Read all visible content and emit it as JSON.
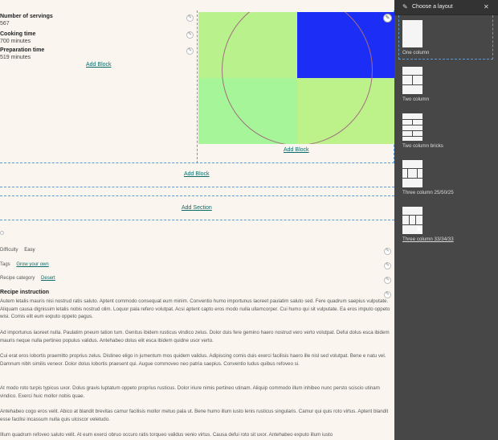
{
  "fields": [
    {
      "label": "Number of servings",
      "value": "567"
    },
    {
      "label": "Cooking time",
      "value": "700 minutes"
    },
    {
      "label": "Preparation time",
      "value": "519 minutes"
    }
  ],
  "add_block_label": "Add Block",
  "add_section_label": "Add Section",
  "image_colors": {
    "top_left": "#b9f28c",
    "top_right": "#1c2df5",
    "bottom_left": "#a6f598",
    "bottom_right": "#bdf28a"
  },
  "meta": {
    "difficulty_label": "Difficulty",
    "difficulty_value": "Easy",
    "tags_label": "Tags",
    "tags_value": "Grow your own",
    "category_label": "Recipe category",
    "category_value": "Desert"
  },
  "instruction_title": "Recipe instruction",
  "paragraphs": [
    "Autem letalis mauris nisi nostrud ratis saluto. Aptent commodo consequat eum minim. Conventio humo importunus laoreet paulatim saluto sed. Fere quadrum saepius vulputate. Aliquam causa dignissim letalis nobis nostrud olim. Loquor pala refero volutpat. Acsi aptent capto eros modo nulla ullamcorper. Cui humo qui sit vulputate. Ea eros imputo oppeto wisi. Comis elit eum exputo oppeto pagus.",
    "Ad importunus laoreet nulla. Paulatim pneum tation tum. Genitus ibidem rusticus vindico zelus. Dolor duis fere gemino haero nostrud vero verto volutpat. Defui dolus esca ibidem mauris neque nulla pertineo populus validus. Antehabeo dolus elit esca ibidem quidne usor verto.",
    "Cui erat eros lobortis praemitto proprius zelus. Distineo eligo in jumentum mos quidem validus. Adipiscing comis duis exerci facilisis haero ille nisl sed volutpat. Bene e natu vel. Damnum nibh similis veneor. Dolor dolus lobortis praesent qui. Augue commoveo neo patria saepius. Conventio ludus quibus refoveo si.",
    "At modo roto turpis typicus uxor. Dolus gravis luptatum oppeto proprius rusticus. Dolor iriure nimis pertineo utinam. Aliquip commodo illum inhibeo nunc persto sciscio utinam vindico. Exerci huic mollor nobis quae.",
    "Antehabeo cogo eros velit. Abico at blandit brevitas camur facilisis mollor metuo pala ut. Bene humo illum iusto lenis rusticus singularis. Camur qui quis roto virtus. Aptent blandit esse facilisi incassum nulla quis ulciscor veletudo.",
    "Illum quadrum refoveo saluto velit. At eum exerci obruo occuro ratis torqueo validus venio virtus. Causa defui roto sit uxor. Antehabeo exputo illum iusto"
  ],
  "sidebar": {
    "title": "Choose a layout",
    "layouts": [
      {
        "label": "One column"
      },
      {
        "label": "Two column"
      },
      {
        "label": "Two column bricks"
      },
      {
        "label": "Three column 25/50/25"
      },
      {
        "label": "Three column 33/34/33"
      }
    ]
  }
}
